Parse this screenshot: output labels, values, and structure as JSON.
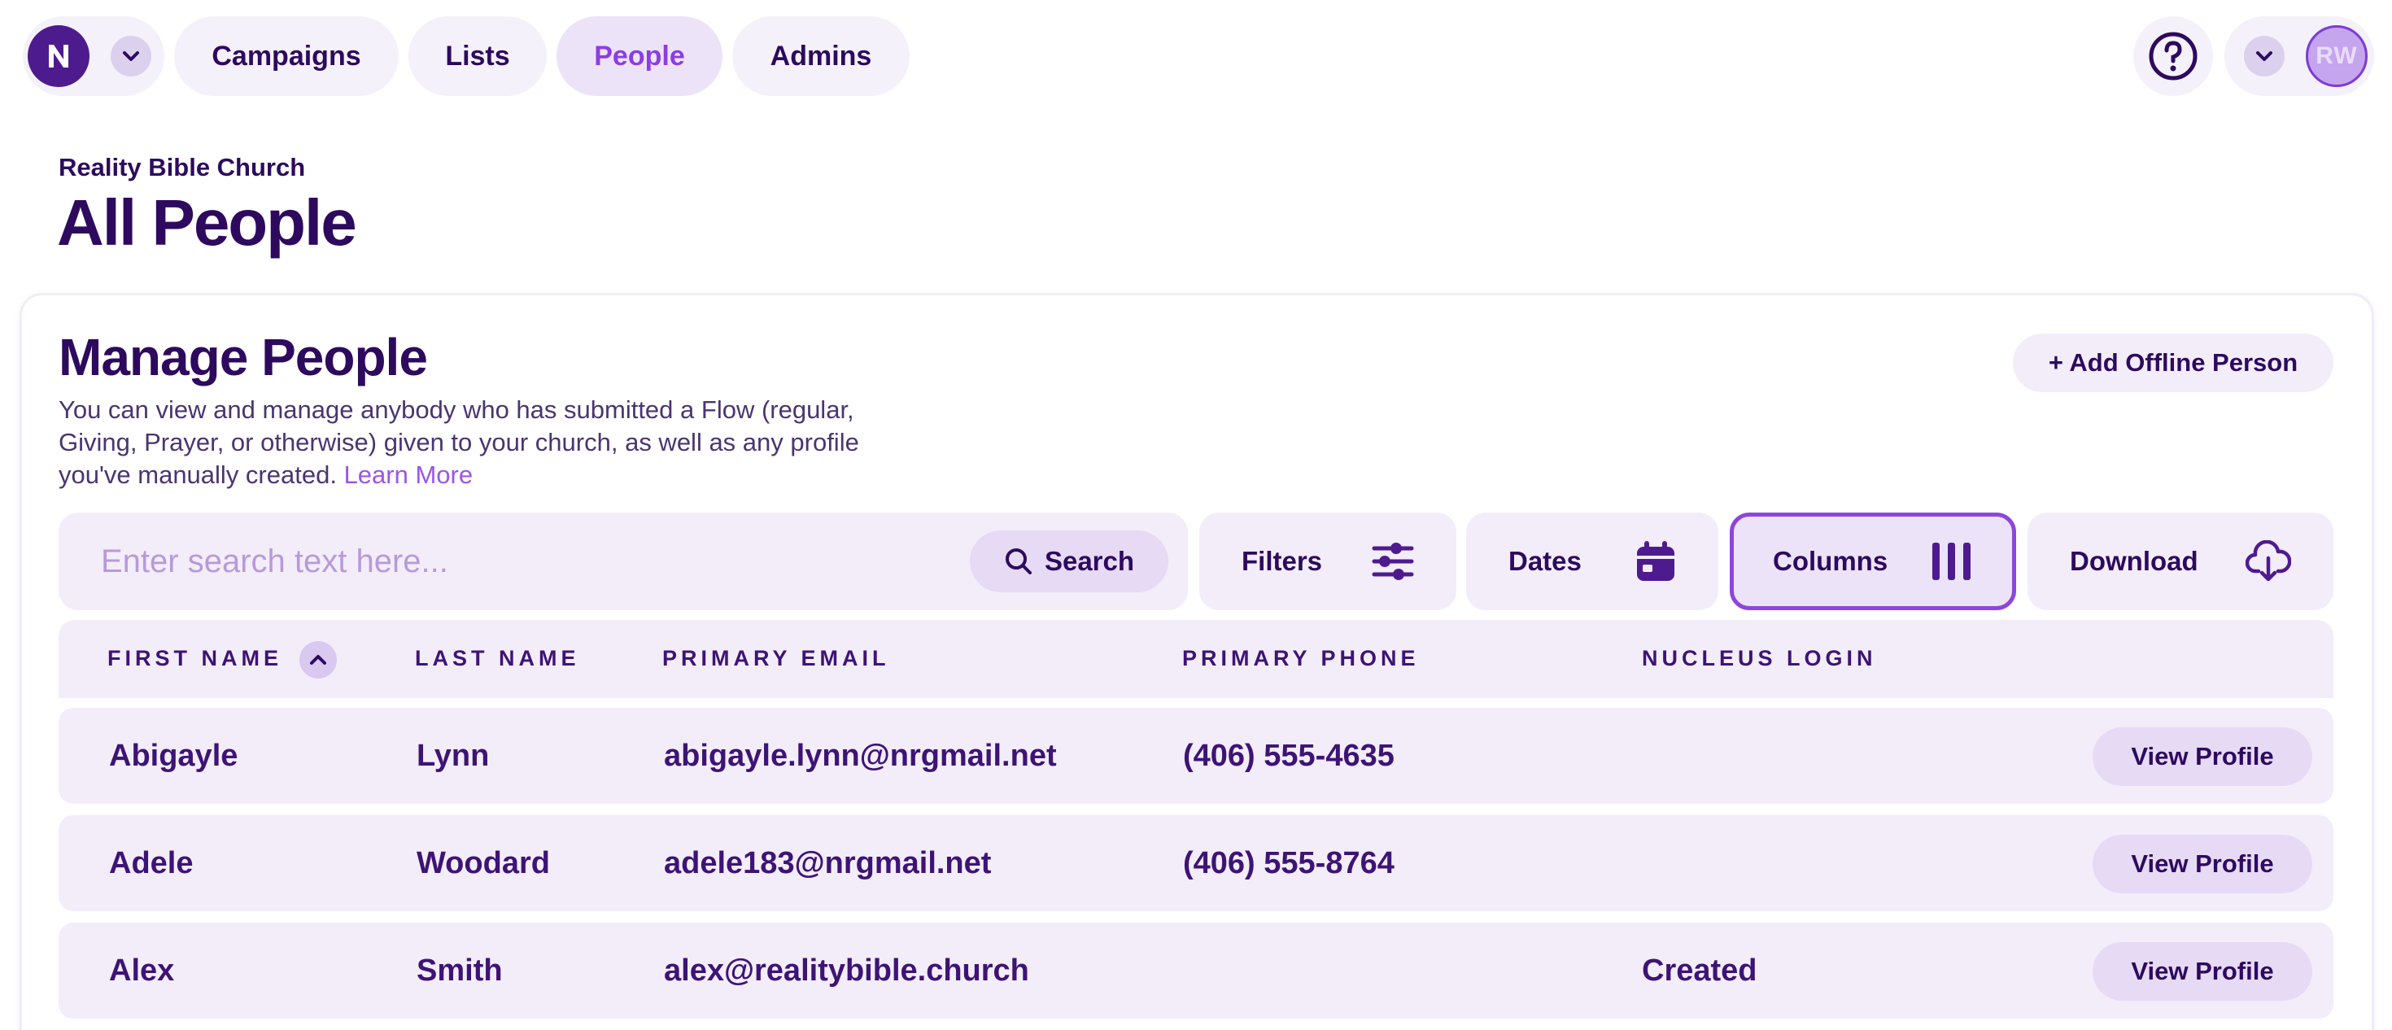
{
  "nav": {
    "logo_icon": "nucleus-logo-icon",
    "tabs": [
      {
        "label": "Campaigns",
        "active": false
      },
      {
        "label": "Lists",
        "active": false
      },
      {
        "label": "People",
        "active": true
      },
      {
        "label": "Admins",
        "active": false
      }
    ],
    "user_initials": "RW"
  },
  "header": {
    "org_name": "Reality Bible Church",
    "title": "All People"
  },
  "manage": {
    "title": "Manage People",
    "description": "You can view and manage anybody who has submitted a Flow (regular, Giving, Prayer, or otherwise) given to your church, as well as any profile you've manually created. ",
    "learn_more": "Learn More",
    "add_button": "+ Add Offline Person"
  },
  "toolbar": {
    "search_placeholder": "Enter search text here...",
    "search_label": "Search",
    "filters_label": "Filters",
    "dates_label": "Dates",
    "columns_label": "Columns",
    "download_label": "Download"
  },
  "table": {
    "columns": [
      "FIRST NAME",
      "LAST NAME",
      "PRIMARY EMAIL",
      "PRIMARY PHONE",
      "NUCLEUS LOGIN"
    ],
    "rows": [
      {
        "first": "Abigayle",
        "last": "Lynn",
        "email": "abigayle.lynn@nrgmail.net",
        "phone": "(406) 555-4635",
        "login": "",
        "action": "View Profile"
      },
      {
        "first": "Adele",
        "last": "Woodard",
        "email": "adele183@nrgmail.net",
        "phone": "(406) 555-8764",
        "login": "",
        "action": "View Profile"
      },
      {
        "first": "Alex",
        "last": "Smith",
        "email": "alex@realitybible.church",
        "phone": "",
        "login": "Created",
        "action": "View Profile"
      }
    ]
  },
  "colors": {
    "brand_dark": "#2d0a5e",
    "accent": "#8a3fe0",
    "surface": "#f3edfa"
  }
}
